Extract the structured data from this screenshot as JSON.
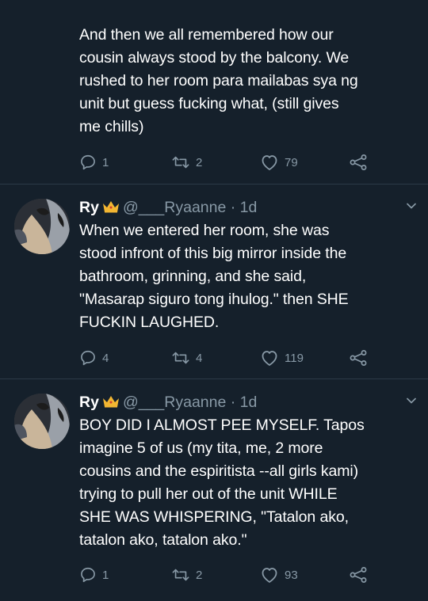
{
  "tweets": [
    {
      "text": "And then we all remembered how our\ncousin always stood by the balcony. We\nrushed to her room para mailabas sya ng\nunit but guess fucking what, (still gives\nme chills)",
      "replies": "1",
      "retweets": "2",
      "likes": "79"
    },
    {
      "name": "Ry",
      "handle": "@___Ryaanne",
      "time": "· 1d",
      "text": "When we entered her room, she was\nstood infront of this big mirror inside the\nbathroom, grinning, and she said,\n\"Masarap siguro tong ihulog.\" then SHE\nFUCKIN LAUGHED.",
      "replies": "4",
      "retweets": "4",
      "likes": "119"
    },
    {
      "name": "Ry",
      "handle": "@___Ryaanne",
      "time": "· 1d",
      "text": "BOY DID I ALMOST PEE MYSELF. Tapos\nimagine 5 of us (my tita, me, 2 more\ncousins and the espiritista --all girls kami)\ntrying to pull her out of the unit WHILE\nSHE WAS WHISPERING, \"Tatalon ako,\ntatalon ako, tatalon ako.\"",
      "replies": "1",
      "retweets": "2",
      "likes": "93"
    }
  ],
  "colors": {
    "background": "#15202b",
    "text": "#ffffff",
    "secondary": "#8899a6",
    "crown": "#f2b632"
  },
  "icons": [
    "reply-icon",
    "retweet-icon",
    "like-icon",
    "share-icon",
    "crown-icon",
    "chevron-down-icon"
  ]
}
